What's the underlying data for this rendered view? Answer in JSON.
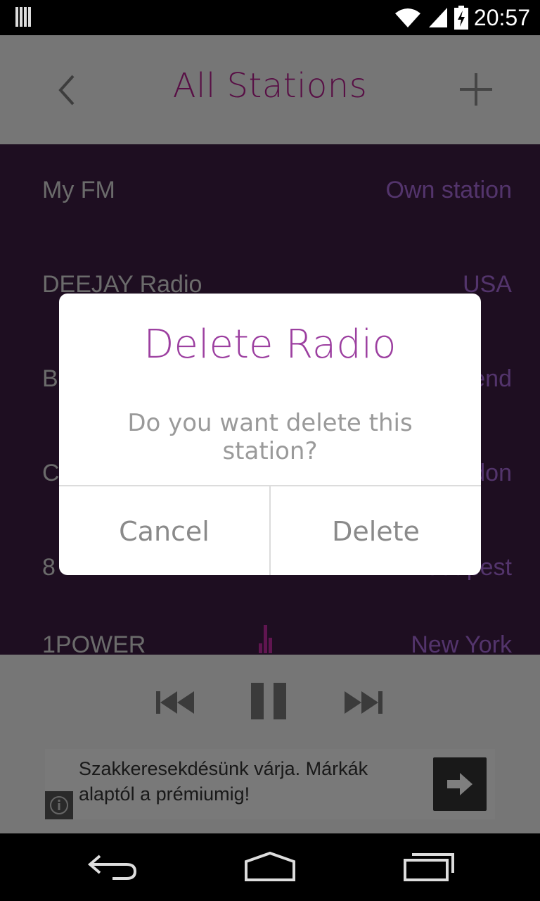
{
  "status_bar": {
    "time": "20:57",
    "icons": [
      "notification-bars-icon",
      "wifi-icon",
      "signal-icon",
      "battery-charging-icon"
    ]
  },
  "app_bar": {
    "title": "All Stations",
    "back_icon": "chevron-left-icon",
    "add_icon": "plus-icon"
  },
  "stations": [
    {
      "name": "My FM",
      "location": "Own station"
    },
    {
      "name": "DEEJAY Radio",
      "location": "USA"
    },
    {
      "name": "B",
      "location": "end"
    },
    {
      "name": "C",
      "location": "don"
    },
    {
      "name": "8",
      "location": "Budapest"
    },
    {
      "name": "1POWER",
      "location": "New York"
    }
  ],
  "player": {
    "controls": [
      "previous-icon",
      "pause-icon",
      "next-icon"
    ]
  },
  "ad": {
    "text": "Szakkeresekdésünk várja. Márkák alaptól a prémiumig!",
    "info_icon": "info-icon",
    "arrow_icon": "arrow-right-icon"
  },
  "dialog": {
    "title": "Delete Radio",
    "message": "Do you want delete this station?",
    "cancel_label": "Cancel",
    "delete_label": "Delete"
  },
  "nav_bar": {
    "icons": [
      "back-icon",
      "home-icon",
      "recent-apps-icon"
    ]
  },
  "colors": {
    "accent": "#b01e8b",
    "dialog_title": "#9c3fa0",
    "list_background": "#3c1c42",
    "location_text": "#a769d8"
  }
}
